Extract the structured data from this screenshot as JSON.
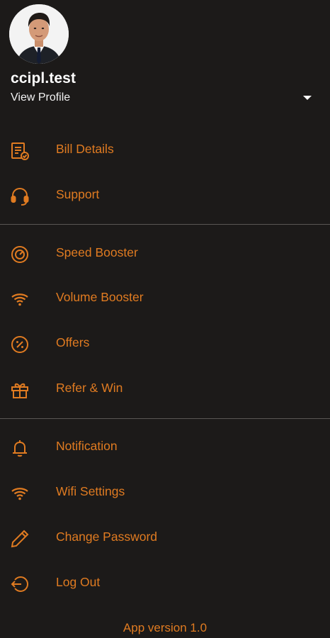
{
  "profile": {
    "username": "ccipl.test",
    "view_profile_label": "View Profile"
  },
  "menu": {
    "group1": [
      {
        "label": "Bill Details",
        "icon": "bill-icon"
      },
      {
        "label": "Support",
        "icon": "headset-icon"
      }
    ],
    "group2": [
      {
        "label": "Speed Booster",
        "icon": "speedometer-icon"
      },
      {
        "label": "Volume Booster",
        "icon": "wifi-icon"
      },
      {
        "label": "Offers",
        "icon": "percent-icon"
      },
      {
        "label": "Refer & Win",
        "icon": "gift-icon"
      }
    ],
    "group3": [
      {
        "label": "Notification",
        "icon": "bell-icon"
      },
      {
        "label": "Wifi Settings",
        "icon": "wifi-icon"
      },
      {
        "label": "Change Password",
        "icon": "pencil-icon"
      },
      {
        "label": "Log Out",
        "icon": "logout-icon"
      }
    ]
  },
  "footer": {
    "app_version": "App version 1.0"
  },
  "colors": {
    "background": "#1c1a19",
    "accent": "#e07b21",
    "divider": "#5a5654",
    "text": "#ffffff"
  }
}
